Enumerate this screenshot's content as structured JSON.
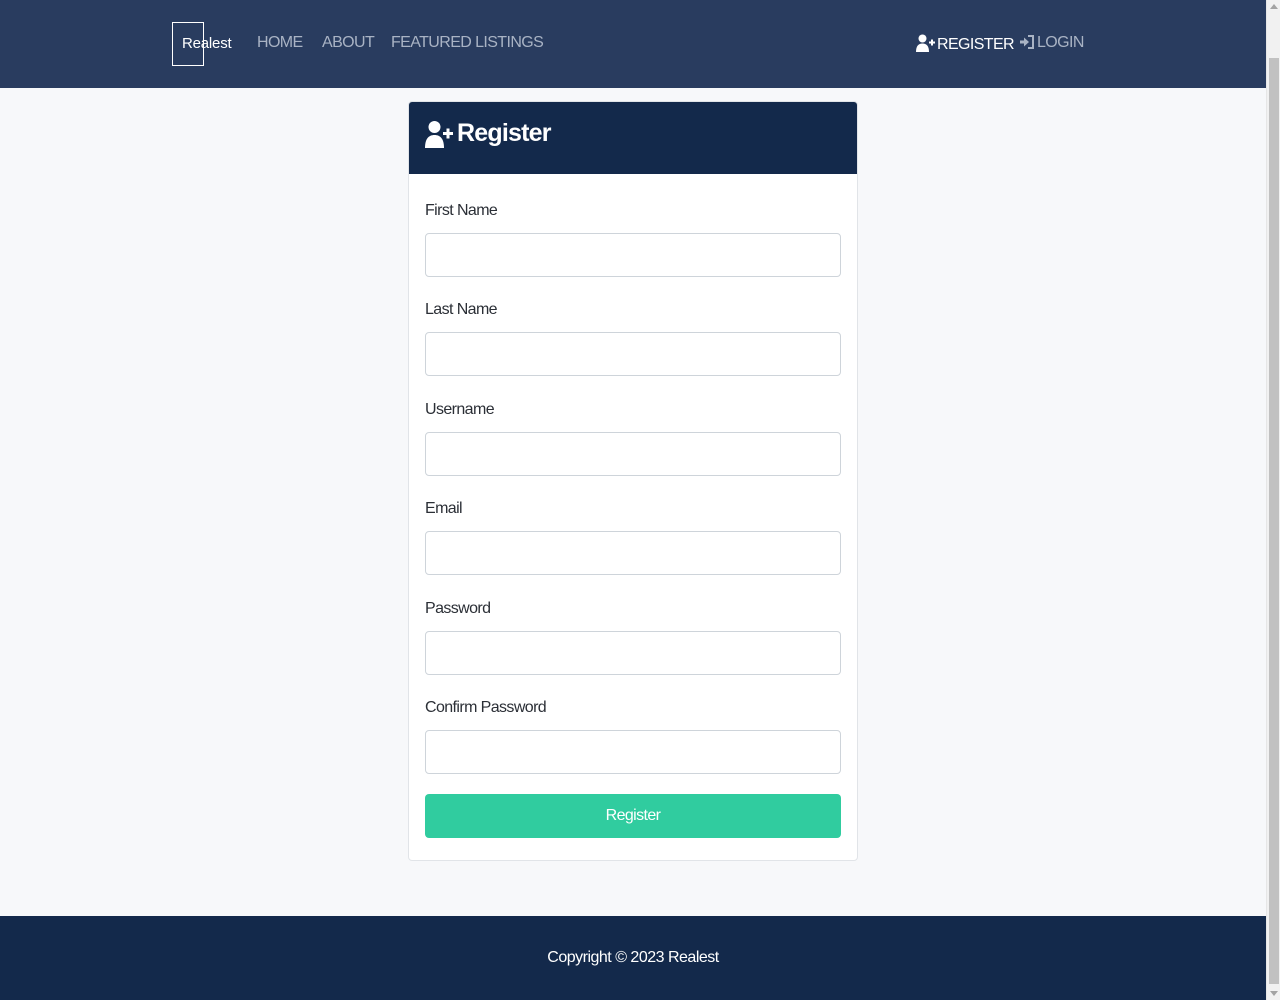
{
  "navbar": {
    "brand": "Realest",
    "links": [
      {
        "label": "HOME"
      },
      {
        "label": "ABOUT"
      },
      {
        "label": "FEATURED LISTINGS"
      }
    ],
    "register": {
      "label": "REGISTER",
      "icon": "user-plus-icon"
    },
    "login": {
      "label": "LOGIN",
      "icon": "sign-in-icon"
    }
  },
  "card": {
    "title": "Register",
    "title_icon": "user-plus-icon",
    "fields": [
      {
        "label": "First Name",
        "value": ""
      },
      {
        "label": "Last Name",
        "value": ""
      },
      {
        "label": "Username",
        "value": ""
      },
      {
        "label": "Email",
        "value": ""
      },
      {
        "label": "Password",
        "value": ""
      },
      {
        "label": "Confirm Password",
        "value": ""
      }
    ],
    "submit_label": "Register"
  },
  "footer": {
    "text": "Copyright © 2023 Realest"
  },
  "colors": {
    "navbar": "#293c5f",
    "header": "#13294b",
    "accent": "#30cc9f",
    "footer": "#13294b"
  }
}
